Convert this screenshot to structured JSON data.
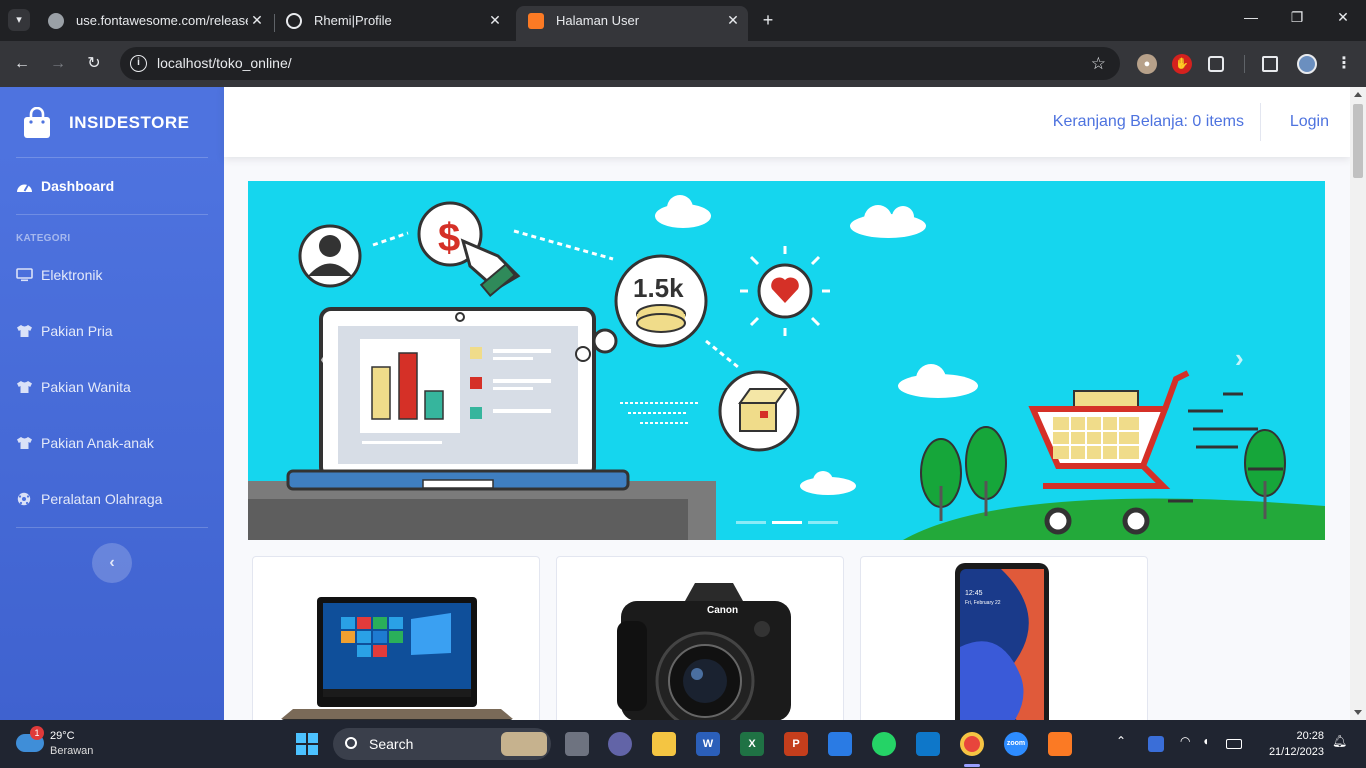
{
  "browser": {
    "tabs": [
      {
        "title": "use.fontawesome.com/releases/",
        "active": false
      },
      {
        "title": "Rhemi|Profile",
        "active": false
      },
      {
        "title": "Halaman User",
        "active": true
      }
    ],
    "url": "localhost/toko_online/"
  },
  "sidebar": {
    "brand": "INSIDESTORE",
    "dashboard_label": "Dashboard",
    "heading": "KATEGORI",
    "items": [
      {
        "label": "Elektronik",
        "icon": "desktop-icon"
      },
      {
        "label": "Pakian Pria",
        "icon": "tshirt-icon"
      },
      {
        "label": "Pakian Wanita",
        "icon": "tshirt-icon"
      },
      {
        "label": "Pakian Anak-anak",
        "icon": "tshirt-icon"
      },
      {
        "label": "Peralatan Olahraga",
        "icon": "football-icon"
      }
    ],
    "toggle_icon": "chevron-left-icon"
  },
  "topbar": {
    "cart_label": "Keranjang Belanja: 0 items",
    "login_label": "Login"
  },
  "carousel": {
    "slide_count": 3,
    "active_index": 1,
    "counter_label": "1.5k"
  },
  "products": [
    {
      "image": "laptop",
      "brand_mark": ""
    },
    {
      "image": "camera",
      "brand_mark": "Canon"
    },
    {
      "image": "smartphone",
      "brand_mark": ""
    }
  ],
  "phone_screen": {
    "time": "12:45",
    "date": "Fri, February 22"
  },
  "taskbar": {
    "weather_temp": "29°C",
    "weather_cond": "Berawan",
    "weather_badge": "1",
    "search_label": "Search",
    "time": "20:28",
    "date": "21/12/2023"
  },
  "colors": {
    "primary": "#4e73df",
    "banner_sky": "#15d6ee"
  }
}
